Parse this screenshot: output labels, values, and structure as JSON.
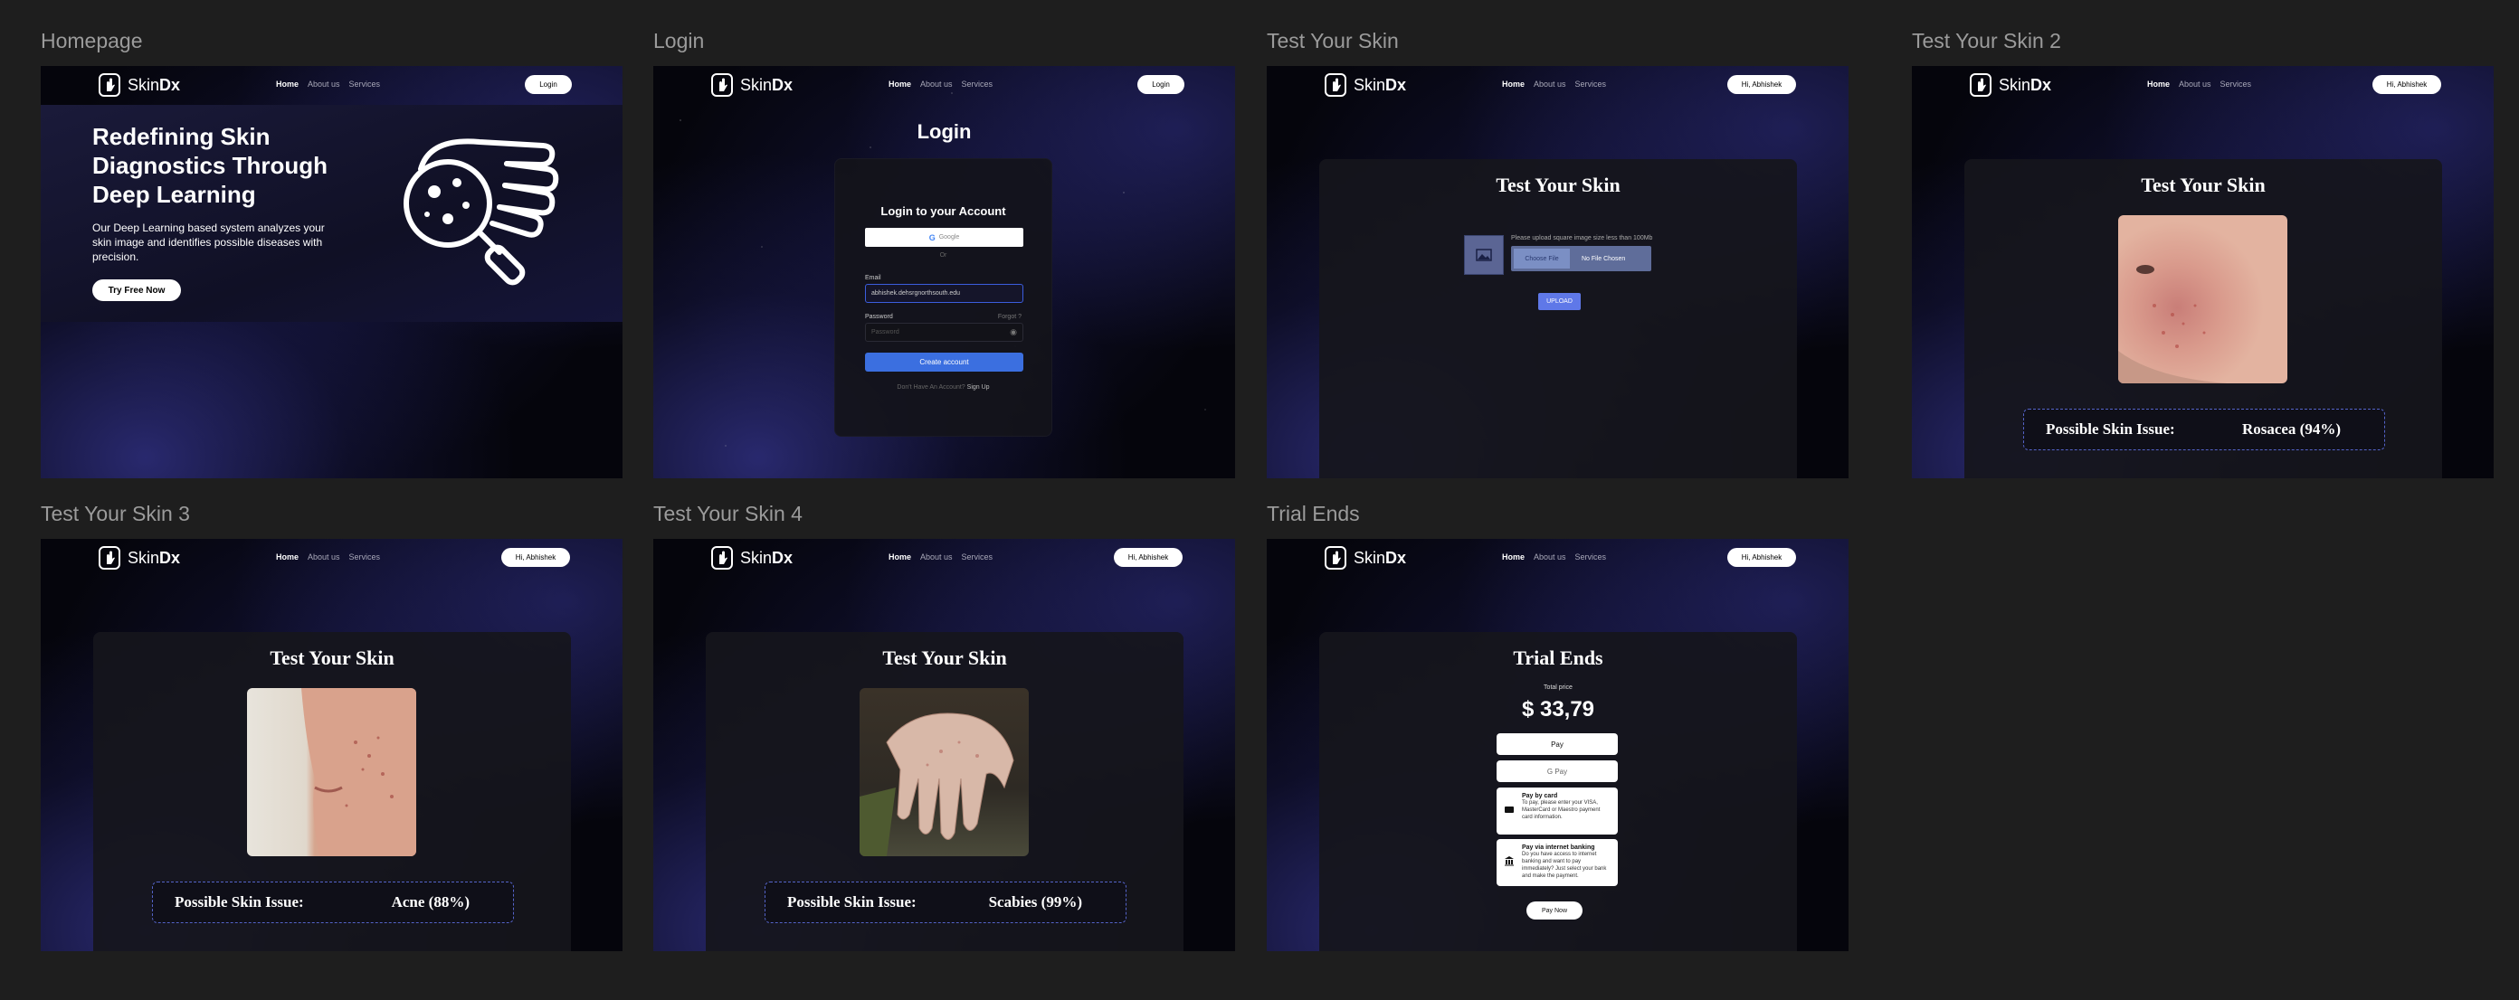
{
  "frames": {
    "homepage": {
      "label": "Homepage",
      "nav_button": "Login",
      "hero_title": "Redefining Skin Diagnostics Through Deep Learning",
      "hero_desc": "Our Deep Learning based system analyzes your skin image and identifies possible diseases with precision.",
      "cta": "Try Free Now"
    },
    "login": {
      "label": "Login",
      "nav_button": "Login",
      "page_title": "Login",
      "card_title": "Login to your Account",
      "google": "Google",
      "or": "Or",
      "email_label": "Email",
      "email_value": "abhishek.dehsrgnorthsouth.edu",
      "password_label": "Password",
      "forgot": "Forgot ?",
      "password_placeholder": "Password",
      "create": "Create account",
      "footer_q": "Don't Have An Account?",
      "footer_link": "Sign Up"
    },
    "test1": {
      "label": "Test Your Skin",
      "nav_button": "Hi, Abhishek",
      "title": "Test Your Skin",
      "upload_note": "Please upload square image size less than 100Mb",
      "choose": "Choose File",
      "nofile": "No File Chosen",
      "upload": "UPLOAD"
    },
    "test2": {
      "label": "Test Your Skin 2",
      "nav_button": "Hi, Abhishek",
      "title": "Test Your Skin",
      "result_label": "Possible Skin Issue:",
      "result_value": "Rosacea (94%)"
    },
    "test3": {
      "label": "Test Your Skin 3",
      "nav_button": "Hi, Abhishek",
      "title": "Test Your Skin",
      "result_label": "Possible Skin Issue:",
      "result_value": "Acne (88%)"
    },
    "test4": {
      "label": "Test Your Skin 4",
      "nav_button": "Hi, Abhishek",
      "title": "Test Your Skin",
      "result_label": "Possible Skin Issue:",
      "result_value": "Scabies (99%)"
    },
    "trial": {
      "label": "Trial Ends",
      "nav_button": "Hi, Abhishek",
      "title": "Trial Ends",
      "total_label": "Total price",
      "price": "$ 33,79",
      "apple_pay": " Pay",
      "google_pay": "G Pay",
      "card_title": "Pay by card",
      "card_desc": "To pay, please enter your VISA, MasterCard or Maestro payment card information.",
      "bank_title": "Pay via internet banking",
      "bank_desc": "Do you have access to internet banking and want to pay immediately? Just select your bank and make the payment.",
      "pay_now": "Pay Now"
    }
  },
  "nav": {
    "brand_regular": "Skin",
    "brand_bold": "Dx",
    "links": [
      "Home",
      "About us",
      "Services"
    ]
  },
  "icons": {
    "logo": "hand-icon",
    "hero": "magnifier-skin-icon",
    "upload": "image-icon"
  }
}
